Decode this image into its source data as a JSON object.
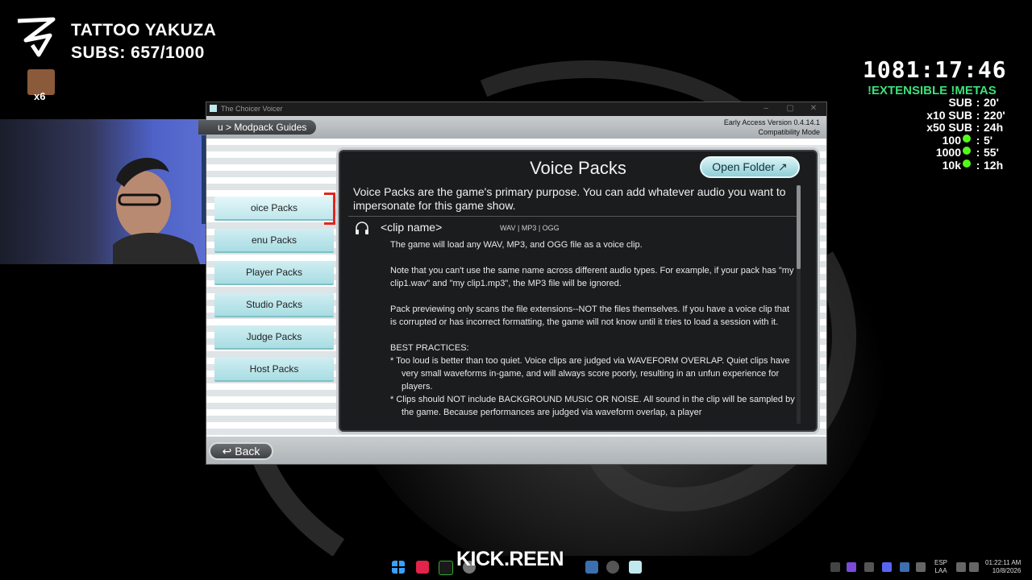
{
  "overlay": {
    "streamer_name": "TATTOO YAKUZA",
    "subs": "SUBS: 657/1000",
    "emote_multiplier": "x6",
    "timer": "1081:17:46",
    "metas_title": "!EXTENSIBLE !METAS",
    "metas": [
      {
        "key": "SUB",
        "value": "20'"
      },
      {
        "key": "x10 SUB",
        "value": "220'"
      },
      {
        "key": "x50 SUB",
        "value": "24h"
      },
      {
        "key": "100",
        "value": "5'",
        "kick_icon": true
      },
      {
        "key": "1000",
        "value": "55'",
        "kick_icon": true
      },
      {
        "key": "10k",
        "value": "12h",
        "kick_icon": true
      }
    ],
    "metas_separator": ":"
  },
  "window": {
    "title": "The Choicer Voicer",
    "breadcrumb": "u > Modpack Guides",
    "version_line1": "Early Access Version 0.4.14.1",
    "version_line2": "Compatibility Mode",
    "controls": [
      "–",
      "▢",
      "✕"
    ]
  },
  "sidebar": {
    "items": [
      {
        "label": "oice Packs",
        "active": true
      },
      {
        "label": "enu Packs",
        "active": false
      },
      {
        "label": "Player Packs",
        "active": false
      },
      {
        "label": "Studio Packs",
        "active": false
      },
      {
        "label": "Judge Packs",
        "active": false
      },
      {
        "label": "Host Packs",
        "active": false
      }
    ]
  },
  "panel": {
    "title": "Voice Packs",
    "open_folder_label": "Open Folder ↗",
    "intro": "Voice Packs are the game's primary purpose. You can add whatever audio you want to impersonate for this game show.",
    "clip_name": "<clip name>",
    "clip_ext": "WAV | MP3 | OGG",
    "paragraphs": [
      "The game will load any WAV, MP3, and OGG file as a voice clip.",
      "Note that you can't use the same name across different audio types. For example, if your pack has \"my clip1.wav\" and \"my clip1.mp3\", the MP3 file will be ignored.",
      "Pack previewing only scans the file extensions--NOT the files themselves. If you have a voice clip that is corrupted or has incorrect formatting, the game will not know until it tries to load a session with it."
    ],
    "best_practices_heading": "BEST PRACTICES:",
    "best_practices": [
      "* Too loud is better than too quiet. Voice clips are judged via WAVEFORM OVERLAP. Quiet clips have very small waveforms in-game, and will always score poorly, resulting in an unfun experience for players.",
      "* Clips should NOT include BACKGROUND MUSIC OR NOISE. All sound in the clip will be sampled by the game. Because performances are judged via waveform overlap, a player"
    ]
  },
  "footer": {
    "back_label": "↩ Back"
  },
  "taskbar": {
    "kick_text": "KICK.REEN",
    "lang_line1": "ESP",
    "lang_line2": "LAA",
    "time": "01:22:11 AM",
    "date": "10/8/2026"
  },
  "colors": {
    "accent_teal": "#a9dde3",
    "highlight_red": "#e3251d",
    "metas_green": "#3de07a",
    "kick_green": "#53fc18",
    "panel_bg": "#1b1c1d"
  }
}
